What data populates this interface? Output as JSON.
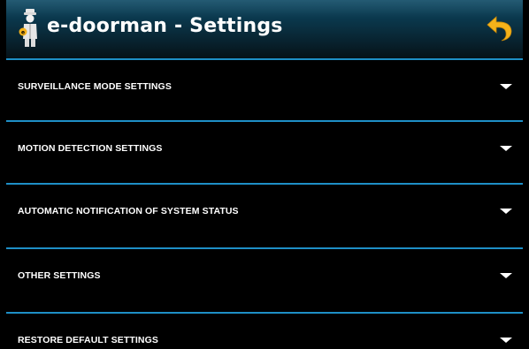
{
  "header": {
    "title": "e-doorman - Settings",
    "logo_icon": "doorman-icon",
    "back_icon": "undo-arrow-icon",
    "accent_color": "#f5b21a"
  },
  "settings": {
    "items": [
      {
        "label": "SURVEILLANCE MODE SETTINGS",
        "icon": "chevron-down-icon"
      },
      {
        "label": "MOTION DETECTION SETTINGS",
        "icon": "chevron-down-icon"
      },
      {
        "label": "AUTOMATIC NOTIFICATION OF SYSTEM STATUS",
        "icon": "chevron-down-icon"
      },
      {
        "label": "OTHER SETTINGS",
        "icon": "chevron-down-icon"
      },
      {
        "label": "RESTORE DEFAULT SETTINGS",
        "icon": "chevron-down-icon"
      }
    ],
    "divider_color": "#1e8fc6"
  }
}
